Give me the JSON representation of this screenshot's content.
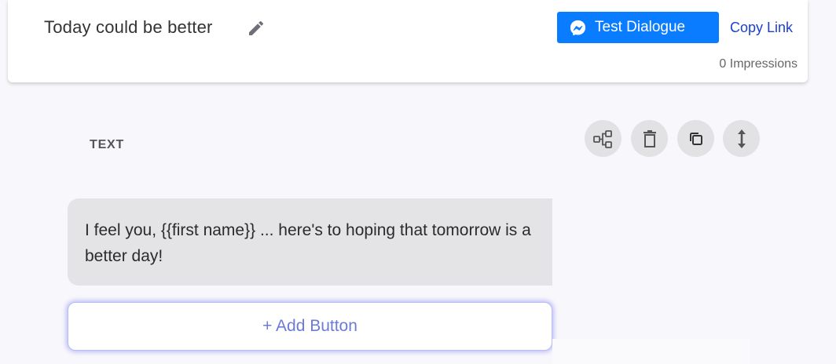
{
  "header": {
    "title": "Today could be better",
    "edit_icon": "pencil-icon",
    "test_button_label": "Test Dialogue",
    "test_button_icon": "messenger-icon",
    "copy_link_label": "Copy Link",
    "impressions_text": "0 Impressions"
  },
  "block": {
    "type_label": "TEXT",
    "tools": [
      {
        "icon": "flow-diagram-icon"
      },
      {
        "icon": "trash-icon"
      },
      {
        "icon": "duplicate-icon"
      },
      {
        "icon": "resize-vertical-icon"
      }
    ],
    "message_text": "I feel you, {{first name}} ... here's to hoping that tomorrow is a better day!",
    "add_button_label": "+ Add Button"
  },
  "colors": {
    "primary_blue": "#0a7cff",
    "link_blue": "#1a3fd6",
    "add_button_text": "#6b7bd6",
    "bubble_background": "#e4e4e6",
    "page_background": "#f8f7fb"
  }
}
